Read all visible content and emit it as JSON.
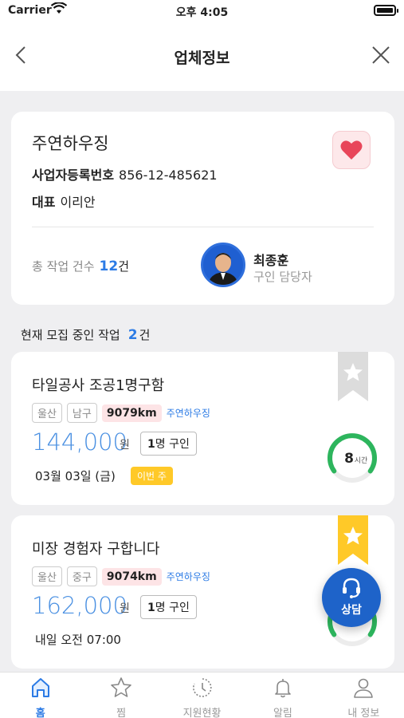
{
  "status_bar": {
    "carrier": "Carrier",
    "time": "오후 4:05"
  },
  "nav": {
    "title": "업체정보"
  },
  "company": {
    "name": "주연하우징",
    "biz_no_label": "사업자등록번호",
    "biz_no": "856-12-485621",
    "rep_label": "대표",
    "rep_name": "이리안",
    "works_label": "총 작업 건수",
    "works_count": "12",
    "works_unit": "건",
    "manager_name": "최종훈",
    "manager_role": "구인 담당자"
  },
  "section": {
    "label": "현재 모집 중인 작업",
    "count": "2",
    "unit": "건"
  },
  "jobs": [
    {
      "title": "타일공사 조공1명구함",
      "tags": [
        "울산",
        "남구"
      ],
      "distance": "9079km",
      "company": "주연하우징",
      "price": "144,000",
      "price_unit": "원",
      "hire_count": "1",
      "hire_label": "명 구인",
      "date": "03월 03일 (금)",
      "badge": "이번 주",
      "hours": "8",
      "hours_unit": "시간",
      "bookmarked": false
    },
    {
      "title": "미장 경험자 구합니다",
      "tags": [
        "울산",
        "중구"
      ],
      "distance": "9074km",
      "company": "주연하우징",
      "price": "162,000",
      "price_unit": "원",
      "hire_count": "1",
      "hire_label": "명 구인",
      "date": "내일 오전 07:00",
      "bookmarked": true
    }
  ],
  "fab": {
    "label": "상담"
  },
  "tabbar": [
    {
      "label": "홈",
      "icon": "home-icon",
      "active": true
    },
    {
      "label": "찜",
      "icon": "star-icon"
    },
    {
      "label": "지원현황",
      "icon": "clock-icon"
    },
    {
      "label": "알림",
      "icon": "bell-icon"
    },
    {
      "label": "내 정보",
      "icon": "person-icon"
    }
  ],
  "colors": {
    "accent": "#2c7be5",
    "price": "#4a90e2",
    "heart": "#e8465a",
    "badge": "#ffc928",
    "gauge": "#2db55d",
    "fab": "#1e63c9"
  }
}
